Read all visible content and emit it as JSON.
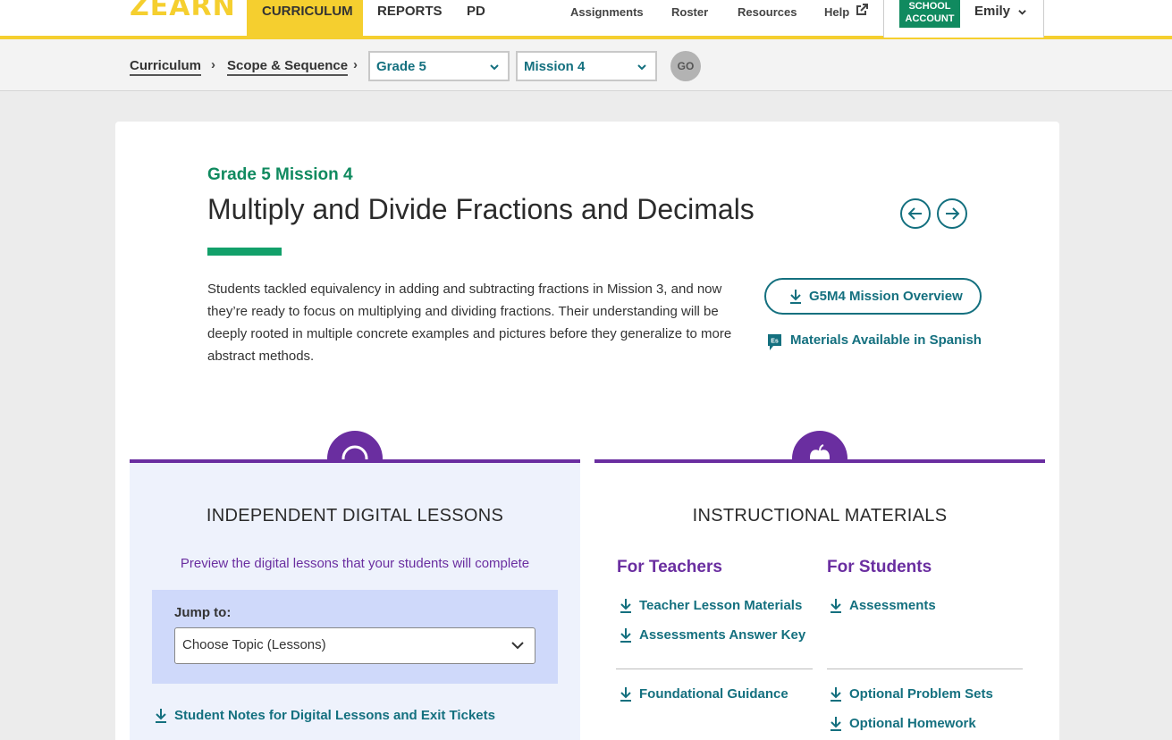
{
  "nav": {
    "logo": "ZEARN",
    "tabs": [
      {
        "label": "CURRICULUM",
        "active": true
      },
      {
        "label": "REPORTS",
        "active": false
      },
      {
        "label": "PD",
        "active": false
      }
    ],
    "links": [
      "Assignments",
      "Roster",
      "Resources",
      "Help"
    ],
    "school_badge": [
      "SCHOOL",
      "ACCOUNT"
    ],
    "user": "Emily"
  },
  "breadcrumb": {
    "items": [
      "Curriculum",
      "Scope & Sequence"
    ],
    "separator": "›",
    "grade_select": "Grade 5",
    "mission_select": "Mission 4",
    "go_label": "GO"
  },
  "mission": {
    "eyebrow": "Grade 5 Mission 4",
    "title": "Multiply and Divide Fractions and Decimals",
    "description": "Students tackled equivalency in adding and subtracting fractions in Mission 3, and now they’re ready to focus on multiplying and dividing fractions. Their understanding will be deeply rooted in multiple concrete examples and pictures before they generalize to more abstract methods.",
    "overview_button": "G5M4 Mission Overview",
    "spanish_link": "Materials Available in Spanish"
  },
  "digital_lessons": {
    "heading": "INDEPENDENT DIGITAL LESSONS",
    "preview_text": "Preview the digital lessons that your students will complete",
    "jump_label": "Jump to:",
    "jump_select": "Choose Topic (Lessons)",
    "student_notes_link": "Student Notes for Digital Lessons and Exit Tickets"
  },
  "instructional": {
    "heading": "INSTRUCTIONAL MATERIALS",
    "teachers": {
      "heading": "For Teachers",
      "links": [
        "Teacher Lesson Materials",
        "Assessments Answer Key"
      ],
      "links_below": [
        "Foundational Guidance"
      ]
    },
    "students": {
      "heading": "For Students",
      "links": [
        "Assessments"
      ],
      "links_below": [
        "Optional Problem Sets",
        "Optional Homework"
      ]
    }
  },
  "colors": {
    "brand_yellow": "#f5cf2f",
    "teal": "#14707f",
    "green": "#108a5f",
    "purple": "#6a2ea0"
  }
}
